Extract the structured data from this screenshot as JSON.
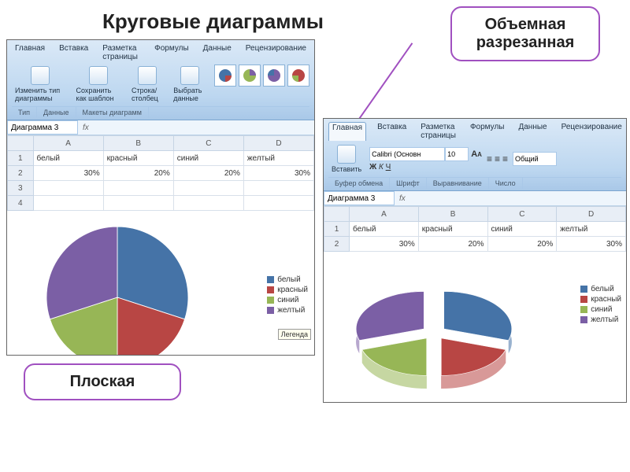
{
  "slide": {
    "title": "Круговые диаграммы"
  },
  "callouts": {
    "flat": "Плоская",
    "exploded": "Объемная разрезанная"
  },
  "excel": {
    "tabs": [
      "Главная",
      "Вставка",
      "Разметка страницы",
      "Формулы",
      "Данные",
      "Рецензирование"
    ],
    "design": {
      "change_type": "Изменить тип диаграммы",
      "save_templ": "Сохранить как шаблон",
      "rowcol": "Строка/столбец",
      "select": "Выбрать данные",
      "grp_type": "Тип",
      "grp_data": "Данные",
      "grp_layout": "Макеты диаграмм"
    },
    "home": {
      "paste": "Вставить",
      "clipboard": "Буфер обмена",
      "font_name": "Calibri (Основн",
      "font_size": "10",
      "font_grp": "Шрифт",
      "align_grp": "Выравнивание",
      "number_fmt": "Общий",
      "number_grp": "Число"
    },
    "namebox": "Диаграмма 3",
    "headers": [
      "",
      "A",
      "B",
      "C",
      "D"
    ],
    "row_labels": [
      "белый",
      "красный",
      "синий",
      "желтый"
    ],
    "row_values": [
      "30%",
      "20%",
      "20%",
      "30%"
    ],
    "legend_tag": "Легенда"
  },
  "colors": {
    "white_series": "#4573a7",
    "red_series": "#b84644",
    "blue_series": "#97b656",
    "yellow_series": "#7b5fa5"
  },
  "chart_data": [
    {
      "type": "pie",
      "title": "Плоская",
      "categories": [
        "белый",
        "красный",
        "синий",
        "желтый"
      ],
      "values": [
        30,
        20,
        20,
        30
      ],
      "series": [
        {
          "name": "белый",
          "value": 30,
          "color": "#4573a7"
        },
        {
          "name": "красный",
          "value": 20,
          "color": "#b84644"
        },
        {
          "name": "синий",
          "value": 20,
          "color": "#97b656"
        },
        {
          "name": "желтый",
          "value": 30,
          "color": "#7b5fa5"
        }
      ],
      "exploded": false,
      "three_d": false
    },
    {
      "type": "pie",
      "title": "Объемная разрезанная",
      "categories": [
        "белый",
        "красный",
        "синий",
        "желтый"
      ],
      "values": [
        30,
        20,
        20,
        30
      ],
      "series": [
        {
          "name": "белый",
          "value": 30,
          "color": "#4573a7"
        },
        {
          "name": "красный",
          "value": 20,
          "color": "#b84644"
        },
        {
          "name": "синий",
          "value": 20,
          "color": "#97b656"
        },
        {
          "name": "желтый",
          "value": 30,
          "color": "#7b5fa5"
        }
      ],
      "exploded": true,
      "three_d": true
    }
  ]
}
